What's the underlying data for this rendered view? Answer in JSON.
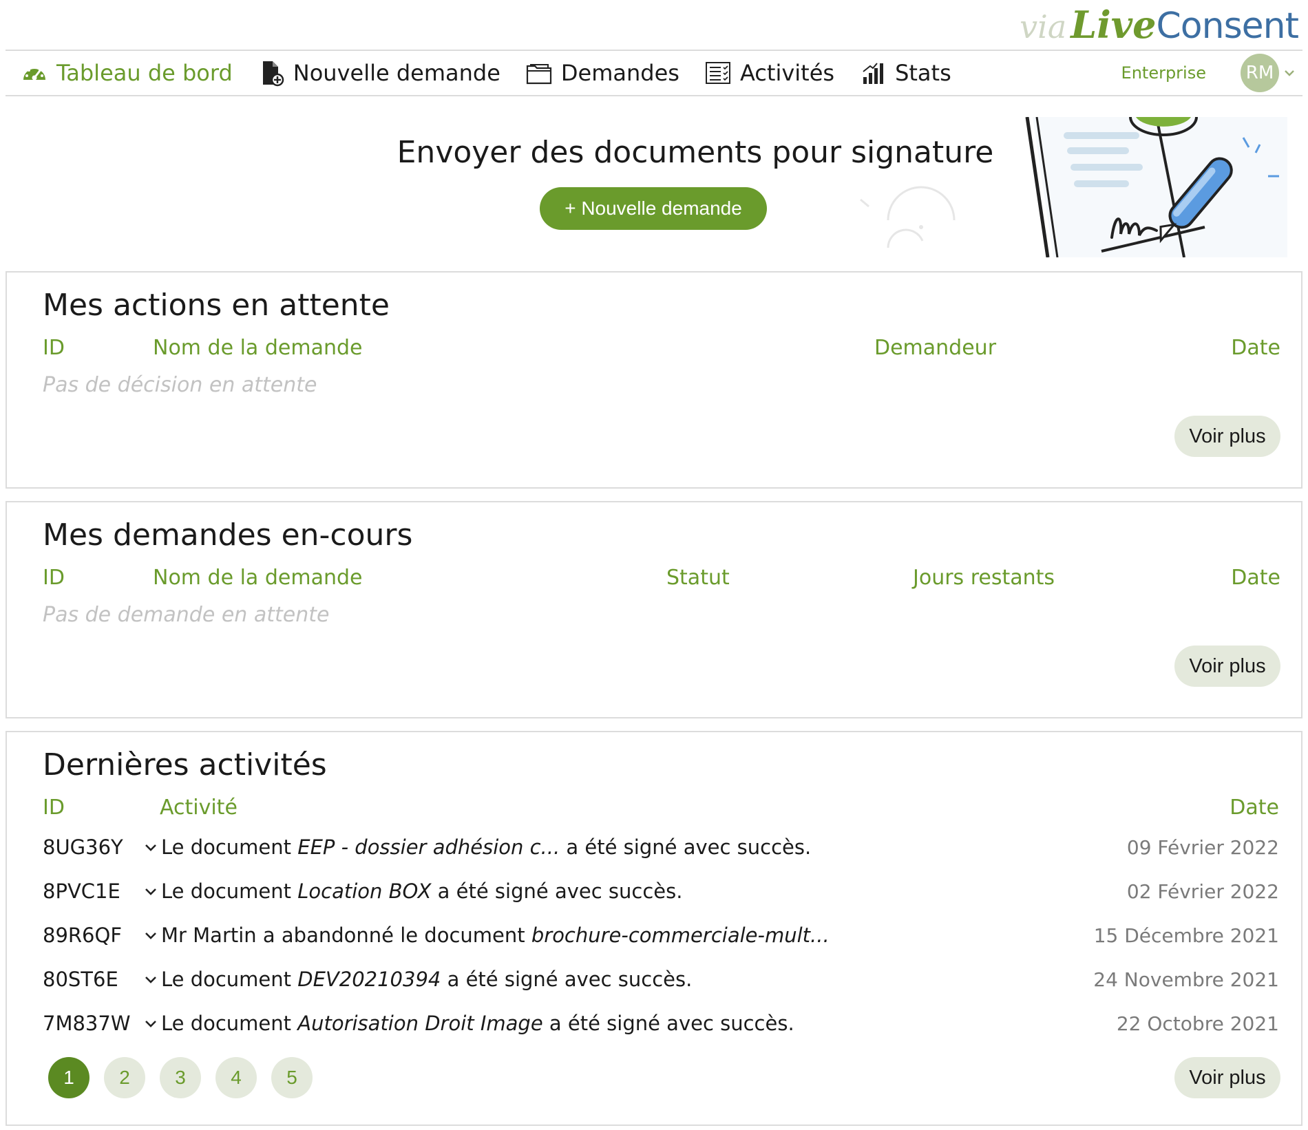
{
  "brand": {
    "via": "via",
    "live": "Live",
    "consent": "Consent"
  },
  "nav": {
    "items": [
      {
        "label": "Tableau de bord",
        "icon": "dashboard-gauge-icon",
        "active": true
      },
      {
        "label": "Nouvelle demande",
        "icon": "new-document-icon"
      },
      {
        "label": "Demandes",
        "icon": "folder-icon"
      },
      {
        "label": "Activités",
        "icon": "activity-list-icon"
      },
      {
        "label": "Stats",
        "icon": "stats-bars-icon"
      }
    ],
    "plan": "Enterprise",
    "avatar_initials": "RM"
  },
  "hero": {
    "title": "Envoyer des documents pour signature",
    "button": "+ Nouvelle demande"
  },
  "pending_actions": {
    "title": "Mes actions en attente",
    "columns": {
      "id": "ID",
      "name": "Nom de la demande",
      "requester": "Demandeur",
      "date": "Date"
    },
    "empty": "Pas de décision en attente",
    "more": "Voir plus"
  },
  "ongoing_requests": {
    "title": "Mes demandes en-cours",
    "columns": {
      "id": "ID",
      "name": "Nom de la demande",
      "status": "Statut",
      "days_left": "Jours restants",
      "date": "Date"
    },
    "empty": "Pas de demande en attente",
    "more": "Voir plus"
  },
  "activities": {
    "title": "Dernières activités",
    "columns": {
      "id": "ID",
      "activity": "Activité",
      "date": "Date"
    },
    "rows": [
      {
        "id": "8UG36Y",
        "prefix": "Le document ",
        "doc": "EEP - dossier adhésion c...",
        "suffix": " a été signé avec succès.",
        "date": "09 Février 2022"
      },
      {
        "id": "8PVC1E",
        "prefix": "Le document ",
        "doc": "Location BOX",
        "suffix": " a été signé avec succès.",
        "date": "02 Février 2022"
      },
      {
        "id": "89R6QF",
        "prefix": "Mr Martin a abandonné le document ",
        "doc": "brochure-commerciale-mult...",
        "suffix": "",
        "date": "15 Décembre 2021"
      },
      {
        "id": "80ST6E",
        "prefix": "Le document ",
        "doc": "DEV20210394",
        "suffix": " a été signé avec succès.",
        "date": "24 Novembre 2021"
      },
      {
        "id": "7M837W",
        "prefix": "Le document ",
        "doc": "Autorisation Droit Image",
        "suffix": " a été signé avec succès.",
        "date": "22 Octobre 2021"
      }
    ],
    "pages": [
      "1",
      "2",
      "3",
      "4",
      "5"
    ],
    "current_page": "1",
    "more": "Voir plus"
  },
  "colors": {
    "accent": "#6a9b2c",
    "accent_dark": "#5b8a22",
    "soft_button": "#e4e9dc",
    "border": "#dcdcdc",
    "muted_text": "#c2c2c2",
    "brand_blue": "#3d6fa3"
  }
}
